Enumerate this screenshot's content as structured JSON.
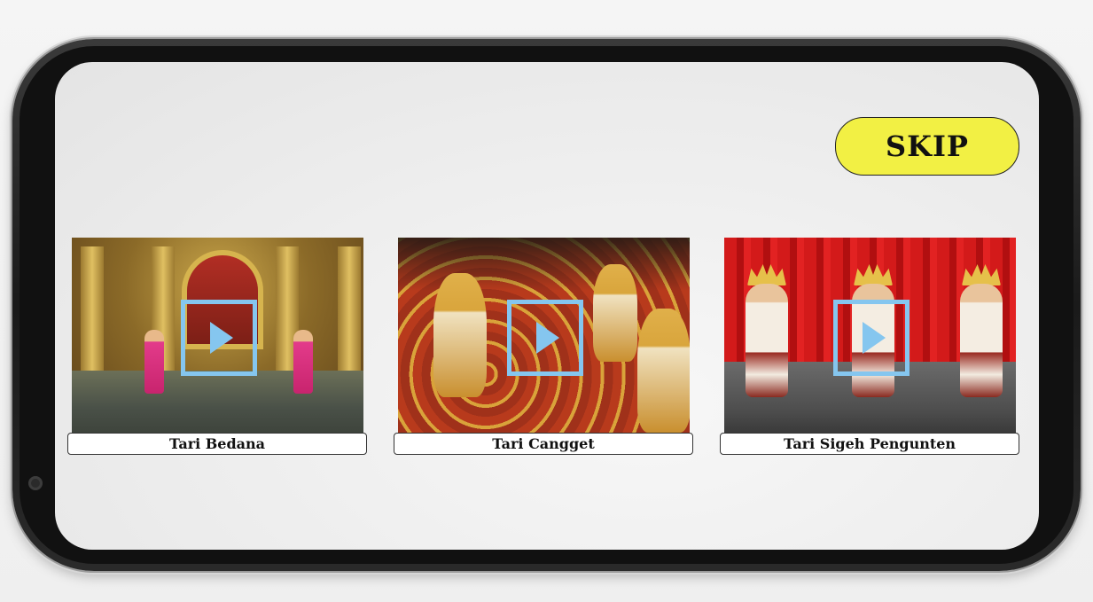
{
  "skip": {
    "label": "SKIP"
  },
  "colors": {
    "skip_button_bg": "#f2f044",
    "play_icon": "#85c6ef"
  },
  "videos": [
    {
      "title": "Tari Bedana"
    },
    {
      "title": "Tari Cangget"
    },
    {
      "title": "Tari Sigeh Pengunten"
    }
  ]
}
